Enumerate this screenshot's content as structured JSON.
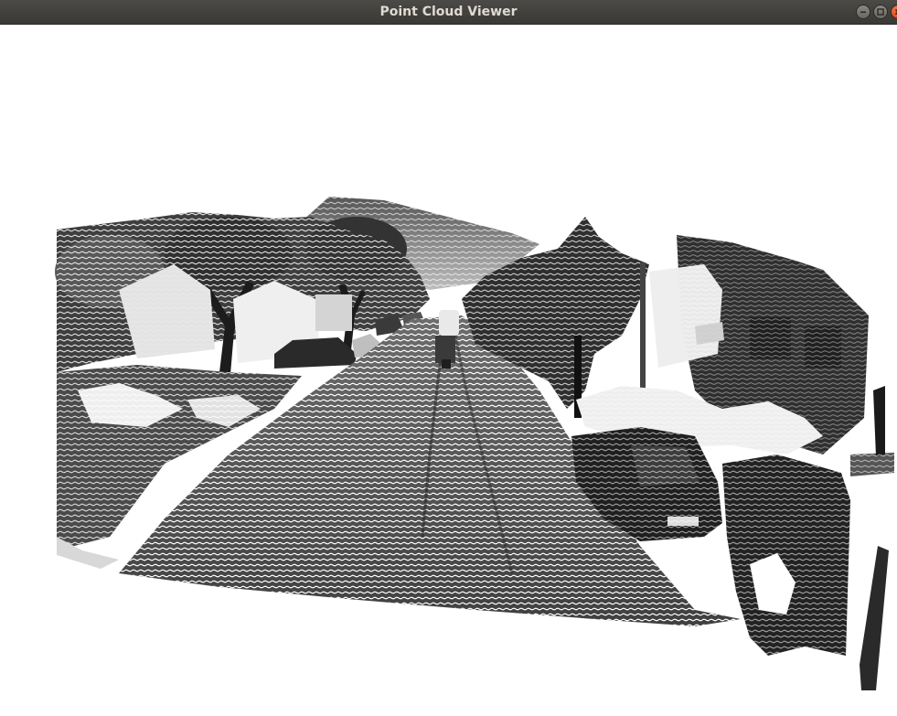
{
  "window": {
    "title": "Point Cloud Viewer",
    "controls": [
      "minimize-icon",
      "maximize-icon",
      "close-icon"
    ],
    "accent_close": "#e95420"
  },
  "viewport": {
    "background": "#ffffff",
    "scene": "point-cloud-street-grayscale"
  }
}
